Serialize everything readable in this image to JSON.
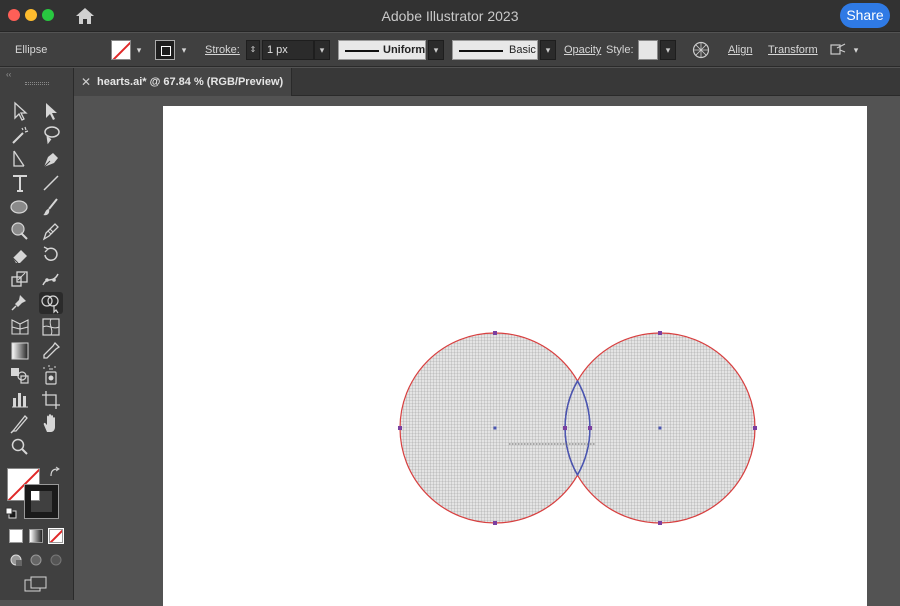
{
  "window": {
    "title": "Adobe Illustrator 2023",
    "share_label": "Share"
  },
  "control_bar": {
    "tool_name": "Ellipse",
    "stroke_label": "Stroke:",
    "stroke_weight": "1 px",
    "profile_label": "Uniform",
    "brush_label": "Basic",
    "opacity_label": "Opacity",
    "style_label": "Style:",
    "align_label": "Align",
    "transform_label": "Transform"
  },
  "document": {
    "tab_title": "hearts.ai* @ 67.84 % (RGB/Preview)",
    "close_glyph": "✕"
  },
  "toolbar": {
    "tools": [
      "selection-tool",
      "direct-selection-tool",
      "magic-wand-tool",
      "lasso-tool",
      "line-segment-tool",
      "pen-tool",
      "type-tool",
      "line-tool",
      "ellipse-tool",
      "paintbrush-tool",
      "shaper-tool",
      "pencil-tool",
      "eraser-tool",
      "rotate-tool",
      "scale-tool",
      "puppet-warp-tool",
      "pin-tool",
      "shape-builder-tool",
      "perspective-grid-tool",
      "mesh-tool",
      "gradient-tool",
      "eyedropper-tool",
      "blend-tool",
      "symbol-sprayer-tool",
      "column-graph-tool",
      "artboard-tool",
      "slice-tool",
      "hand-tool",
      "zoom-tool"
    ],
    "active_tool": "shape-builder-tool"
  },
  "colors": {
    "selection_stroke": "#d84040",
    "path_highlight": "#4a55b0",
    "anchor": "#7a3fa0",
    "shape_fill": "#d9d9d9",
    "accent": "#2f7ae5"
  }
}
